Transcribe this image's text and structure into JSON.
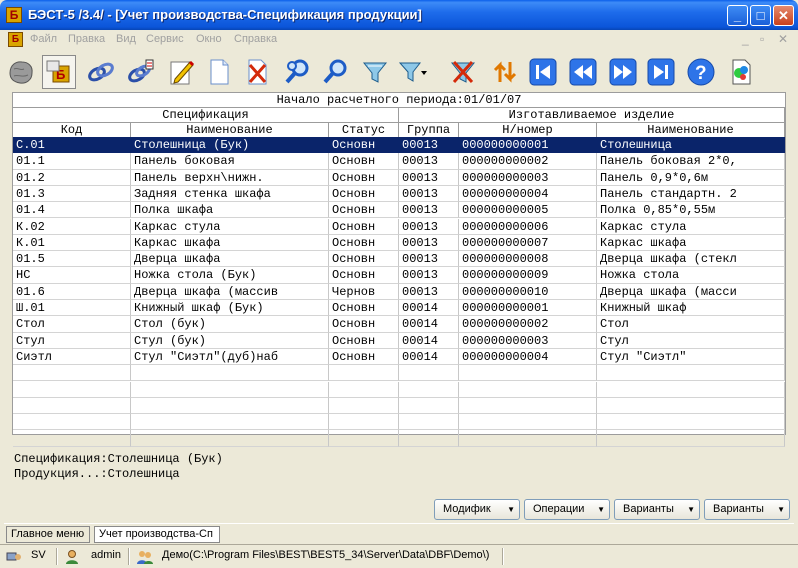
{
  "window": {
    "title": "БЭСТ-5 /3.4/ - [Учет производства-Спецификация продукции]",
    "icon_letter": "Б",
    "controls": {
      "minimize": "_",
      "maximize": "□",
      "close": "✕"
    }
  },
  "menu": {
    "items": [
      "Файл",
      "Правка",
      "Вид",
      "Сервис",
      "Окно",
      "Справка"
    ],
    "mdi_controls": [
      "_",
      "▫",
      "✕"
    ]
  },
  "toolbar": {
    "buttons": [
      "world-icon",
      "best-module-icon",
      "link-icon",
      "link-edit-icon",
      "pencil-edit-icon",
      "new-document-icon",
      "delete-icon",
      "find-icon",
      "find-next-icon",
      "filter-icon",
      "filter-dropdown-icon",
      "clear-filter-icon",
      "sort-icon",
      "first-record-icon",
      "previous-record-icon",
      "next-record-icon",
      "last-record-icon",
      "help-icon",
      "report-icon"
    ]
  },
  "grid": {
    "period_label": "Начало расчетного периода:01/01/07",
    "group_headers": {
      "spec": "Спецификация",
      "product": "Изготавливаемое изделие"
    },
    "columns": [
      "Код",
      "Наименование",
      "Статус",
      "Группа",
      "Н/номер",
      "Наименование"
    ],
    "rows": [
      [
        "С.01",
        "Столешница (Бук)",
        "Основн",
        "00013",
        "000000000001",
        "Столешница"
      ],
      [
        "01.1",
        "Панель боковая",
        "Основн",
        "00013",
        "000000000002",
        "Панель боковая 2*0,"
      ],
      [
        "01.2",
        "Панель верхн\\нижн.",
        "Основн",
        "00013",
        "000000000003",
        "Панель 0,9*0,6м"
      ],
      [
        "01.3",
        "Задняя стенка шкафа",
        "Основн",
        "00013",
        "000000000004",
        "Панель стандартн. 2"
      ],
      [
        "01.4",
        "Полка шкафа",
        "Основн",
        "00013",
        "000000000005",
        "Полка 0,85*0,55м"
      ],
      [
        "К.02",
        "Каркас стула",
        "Основн",
        "00013",
        "000000000006",
        "Каркас стула"
      ],
      [
        "К.01",
        "Каркас шкафа",
        "Основн",
        "00013",
        "000000000007",
        "Каркас шкафа"
      ],
      [
        "01.5",
        "Дверца шкафа",
        "Основн",
        "00013",
        "000000000008",
        "Дверца шкафа (стекл"
      ],
      [
        "НС",
        "Ножка стола (Бук)",
        "Основн",
        "00013",
        "000000000009",
        "Ножка стола"
      ],
      [
        "01.6",
        "Дверца шкафа (массив",
        "Чернов",
        "00013",
        "000000000010",
        "Дверца шкафа (масси"
      ],
      [
        "Ш.01",
        "Книжный шкаф (Бук)",
        "Основн",
        "00014",
        "000000000001",
        "Книжный шкаф"
      ],
      [
        "Стол",
        "Стол (бук)",
        "Основн",
        "00014",
        "000000000002",
        "Стол"
      ],
      [
        "Стул",
        "Стул (бук)",
        "Основн",
        "00014",
        "000000000003",
        "Стул"
      ],
      [
        "Сиэтл",
        "Стул \"Сиэтл\"(дуб)наб",
        "Основн",
        "00014",
        "000000000004",
        "Стул \"Сиэтл\""
      ]
    ],
    "empty_rows": 5,
    "selected_row": 0
  },
  "info": {
    "spec_line": "Спецификация:Столешница (Бук)",
    "product_line": "Продукция...:Столешница"
  },
  "action_buttons": [
    "Модифик",
    "Операции",
    "Варианты",
    "Варианты"
  ],
  "tasks": [
    "Главное меню",
    "Учет производства-Сп"
  ],
  "status": {
    "user_short": "SV",
    "user": "admin",
    "database": "Демо(C:\\Program Files\\BEST\\BEST5_34\\Server\\Data\\DBF\\Demo\\)"
  },
  "colors": {
    "selection": "#0A246A",
    "title_bar": "#0B55D9",
    "face": "#ECE9D8"
  }
}
